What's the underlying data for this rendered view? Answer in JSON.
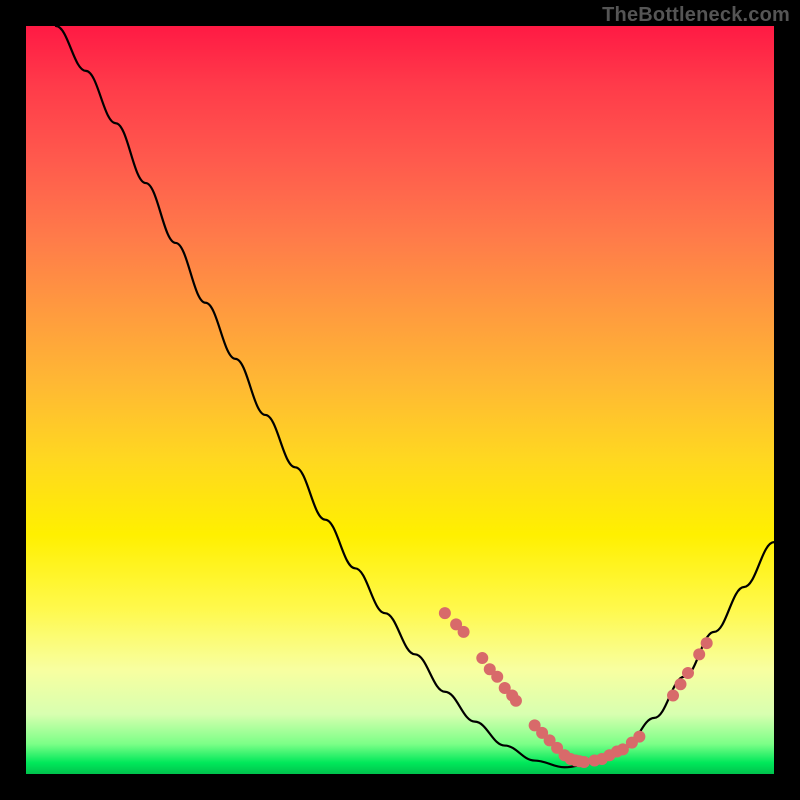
{
  "attribution": "TheBottleneck.com",
  "chart_data": {
    "type": "line",
    "title": "",
    "xlabel": "",
    "ylabel": "",
    "xlim": [
      0,
      100
    ],
    "ylim": [
      0,
      100
    ],
    "grid": false,
    "legend": false,
    "colors": {
      "gradient_top": "#ff1a44",
      "gradient_mid": "#fff000",
      "gradient_bottom": "#00c24d",
      "curve": "#000000",
      "marker": "#d86a6a"
    },
    "curve_points_pct": [
      [
        4.0,
        100.0
      ],
      [
        8.0,
        94.0
      ],
      [
        12.0,
        87.0
      ],
      [
        16.0,
        79.0
      ],
      [
        20.0,
        71.0
      ],
      [
        24.0,
        63.0
      ],
      [
        28.0,
        55.5
      ],
      [
        32.0,
        48.0
      ],
      [
        36.0,
        41.0
      ],
      [
        40.0,
        34.0
      ],
      [
        44.0,
        27.5
      ],
      [
        48.0,
        21.5
      ],
      [
        52.0,
        16.0
      ],
      [
        56.0,
        11.0
      ],
      [
        60.0,
        7.0
      ],
      [
        64.0,
        3.8
      ],
      [
        68.0,
        1.8
      ],
      [
        72.0,
        0.9
      ],
      [
        76.0,
        1.5
      ],
      [
        80.0,
        3.5
      ],
      [
        84.0,
        7.5
      ],
      [
        88.0,
        13.0
      ],
      [
        92.0,
        19.0
      ],
      [
        96.0,
        25.0
      ],
      [
        100.0,
        31.0
      ]
    ],
    "markers_pct": [
      [
        56.0,
        21.5
      ],
      [
        57.5,
        20.0
      ],
      [
        58.5,
        19.0
      ],
      [
        61.0,
        15.5
      ],
      [
        62.0,
        14.0
      ],
      [
        63.0,
        13.0
      ],
      [
        64.0,
        11.5
      ],
      [
        65.0,
        10.5
      ],
      [
        65.5,
        9.8
      ],
      [
        68.0,
        6.5
      ],
      [
        69.0,
        5.5
      ],
      [
        70.0,
        4.5
      ],
      [
        71.0,
        3.5
      ],
      [
        72.0,
        2.5
      ],
      [
        72.8,
        2.0
      ],
      [
        73.5,
        1.8
      ],
      [
        74.0,
        1.7
      ],
      [
        74.6,
        1.6
      ],
      [
        76.0,
        1.8
      ],
      [
        77.0,
        2.0
      ],
      [
        78.0,
        2.5
      ],
      [
        79.0,
        3.0
      ],
      [
        79.8,
        3.3
      ],
      [
        81.0,
        4.2
      ],
      [
        82.0,
        5.0
      ],
      [
        86.5,
        10.5
      ],
      [
        87.5,
        12.0
      ],
      [
        88.5,
        13.5
      ],
      [
        90.0,
        16.0
      ],
      [
        91.0,
        17.5
      ]
    ]
  }
}
